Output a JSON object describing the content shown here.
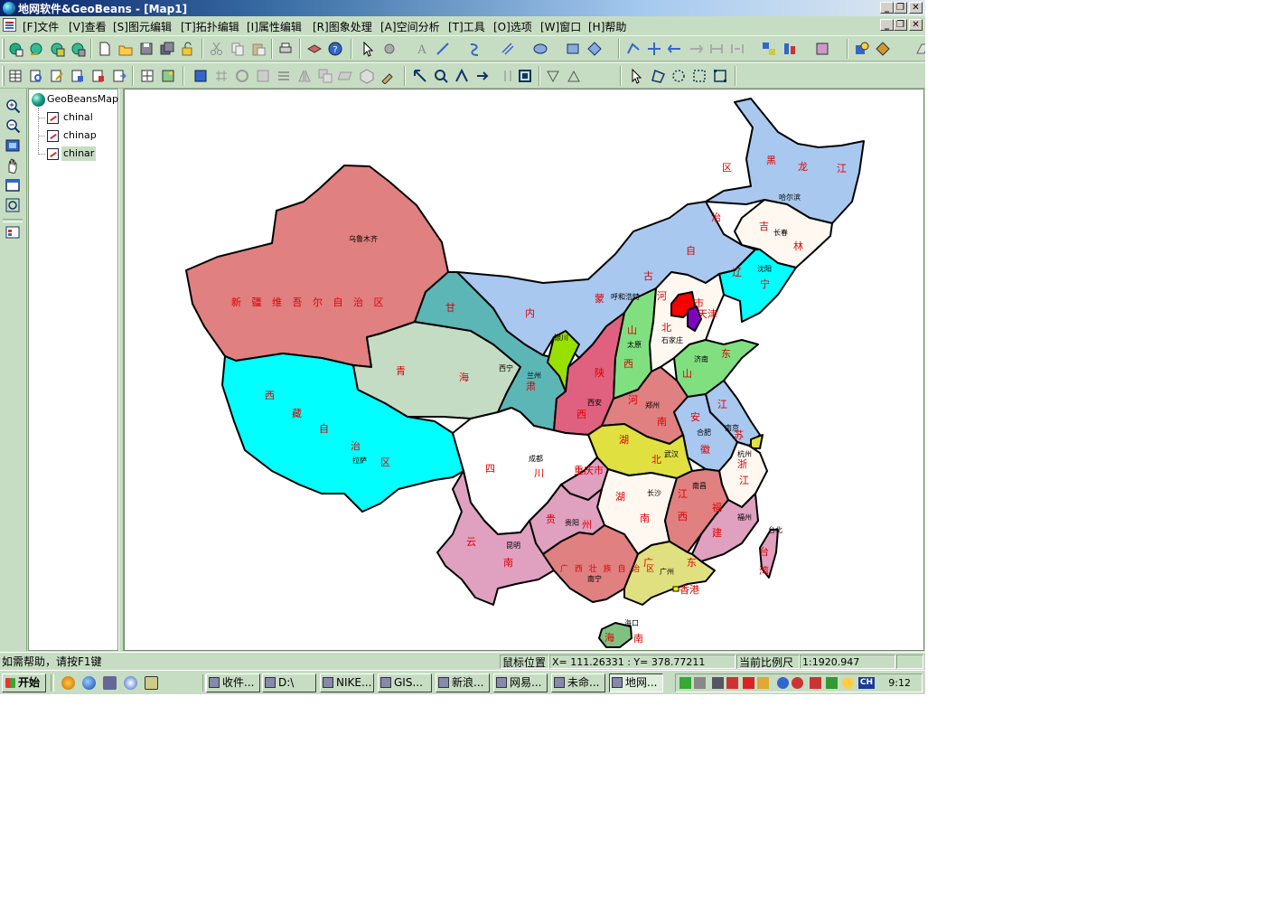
{
  "window": {
    "title": "地网软件&GeoBeans - [Map1]",
    "buttons": [
      "_",
      "❐",
      "✕"
    ]
  },
  "menu": [
    "[F]文件",
    "[V]查看",
    "[S]图元编辑",
    "[T]拓扑编辑",
    "[I]属性编辑",
    "[R]图象处理",
    "[A]空间分析",
    "[T]工具",
    "[O]选项",
    "[W]窗口",
    "[H]帮助"
  ],
  "tree": {
    "root": "GeoBeansMap",
    "layers": [
      "chinal",
      "chinap",
      "chinar"
    ],
    "selected": "chinar"
  },
  "map": {
    "provinces": [
      {
        "name": "新疆维吾尔自治区",
        "color": "#e08080"
      },
      {
        "name": "西藏自治区",
        "color": "#00ffff"
      },
      {
        "name": "青海",
        "color": "#c4dcc4"
      },
      {
        "name": "甘肃",
        "color": "#5cb6b6"
      },
      {
        "name": "内蒙古自治区",
        "color": "#a8c8f0"
      },
      {
        "name": "黑龙江",
        "color": "#a8c8f0"
      },
      {
        "name": "吉林",
        "color": "#fff8f0"
      },
      {
        "name": "辽宁",
        "color": "#00ffff"
      },
      {
        "name": "宁夏",
        "color": "#98e000"
      },
      {
        "name": "陕西",
        "color": "#e06080"
      },
      {
        "name": "山西",
        "color": "#80e080"
      },
      {
        "name": "河北",
        "color": "#fff8f0"
      },
      {
        "name": "北京市",
        "color": "#ff0000"
      },
      {
        "name": "天津",
        "color": "#8000c0"
      },
      {
        "name": "山东",
        "color": "#80e080"
      },
      {
        "name": "河南",
        "color": "#e08080"
      },
      {
        "name": "江苏",
        "color": "#a8c8f0"
      },
      {
        "name": "安徽",
        "color": "#a8c8f0"
      },
      {
        "name": "上海",
        "color": "#e0e040"
      },
      {
        "name": "浙江",
        "color": "#fff8f0"
      },
      {
        "name": "湖北",
        "color": "#e0e040"
      },
      {
        "name": "四川",
        "color": "#ffffff"
      },
      {
        "name": "重庆市",
        "color": "#e0a0c0"
      },
      {
        "name": "湖南",
        "color": "#fff8f0"
      },
      {
        "name": "江西",
        "color": "#e08080"
      },
      {
        "name": "福建",
        "color": "#e0a0c0"
      },
      {
        "name": "贵州",
        "color": "#e0a0c0"
      },
      {
        "name": "云南",
        "color": "#e0a0c0"
      },
      {
        "name": "广西壮族自治区",
        "color": "#e08080"
      },
      {
        "name": "广东",
        "color": "#e0e080"
      },
      {
        "name": "台湾",
        "color": "#e0a0c0"
      },
      {
        "name": "海南",
        "color": "#80c080"
      }
    ],
    "province_labels": {
      "xinjiang": "新 疆 维 吾 尔 自 治 区",
      "xizang": [
        "西",
        "藏",
        "自",
        "治",
        "区"
      ],
      "qinghai": [
        "青",
        "海"
      ],
      "gansu": [
        "甘",
        "肃"
      ],
      "neimenggu": [
        "内",
        "蒙",
        "古",
        "自",
        "治",
        "区"
      ],
      "heilongjiang": [
        "黑",
        "龙",
        "江"
      ],
      "jilin": [
        "吉",
        "林"
      ],
      "liaoning": [
        "辽",
        "宁"
      ],
      "shaanxi": [
        "陕",
        "西"
      ],
      "shanxi": [
        "山",
        "西"
      ],
      "hebei": [
        "河",
        "北"
      ],
      "beijing": "北京市",
      "tianjin": "天津",
      "shandong": [
        "山",
        "东"
      ],
      "henan": [
        "河",
        "南"
      ],
      "jiangsu": [
        "江",
        "苏"
      ],
      "anhui": [
        "安",
        "徽"
      ],
      "zhejiang": [
        "浙",
        "江"
      ],
      "hubei": [
        "湖",
        "北"
      ],
      "sichuan": [
        "四",
        "川"
      ],
      "chongqing": "重庆市",
      "hunan": [
        "湖",
        "南"
      ],
      "jiangxi": [
        "江",
        "西"
      ],
      "fujian": [
        "福",
        "建"
      ],
      "guizhou": [
        "贵",
        "州"
      ],
      "yunnan": [
        "云",
        "南"
      ],
      "guangxi": "广 西 壮 族 自 治 区",
      "guangdong": [
        "广",
        "东"
      ],
      "xianggang": "香港",
      "taiwan": [
        "台",
        "湾"
      ],
      "hainan": [
        "海",
        "南"
      ]
    },
    "cities": [
      "乌鲁木齐",
      "拉萨",
      "西宁",
      "兰州",
      "银川",
      "呼和浩特",
      "哈尔滨",
      "长春",
      "沈阳",
      "太原",
      "石家庄",
      "济南",
      "郑州",
      "西安",
      "成都",
      "重庆市",
      "武汉",
      "合肥",
      "南京",
      "杭州",
      "长沙",
      "南昌",
      "福州",
      "贵阳",
      "昆明",
      "南宁",
      "广州",
      "台北",
      "海口"
    ]
  },
  "status": {
    "help": "如需帮助，请按F1键",
    "mouse_pos_label": "鼠标位置",
    "coords": "X=  111.26331 : Y=   378.77211",
    "scale_label": "当前比例尺",
    "scale_value": "1:1920.947"
  },
  "taskbar": {
    "start": "开始",
    "tasks": [
      "收件...",
      "D:\\",
      "NIKE...",
      "GIS...",
      "新浪...",
      "网易...",
      "未命...",
      "地网..."
    ],
    "active_task": "地网...",
    "tray_lang": "CH",
    "clock": "9:12"
  }
}
